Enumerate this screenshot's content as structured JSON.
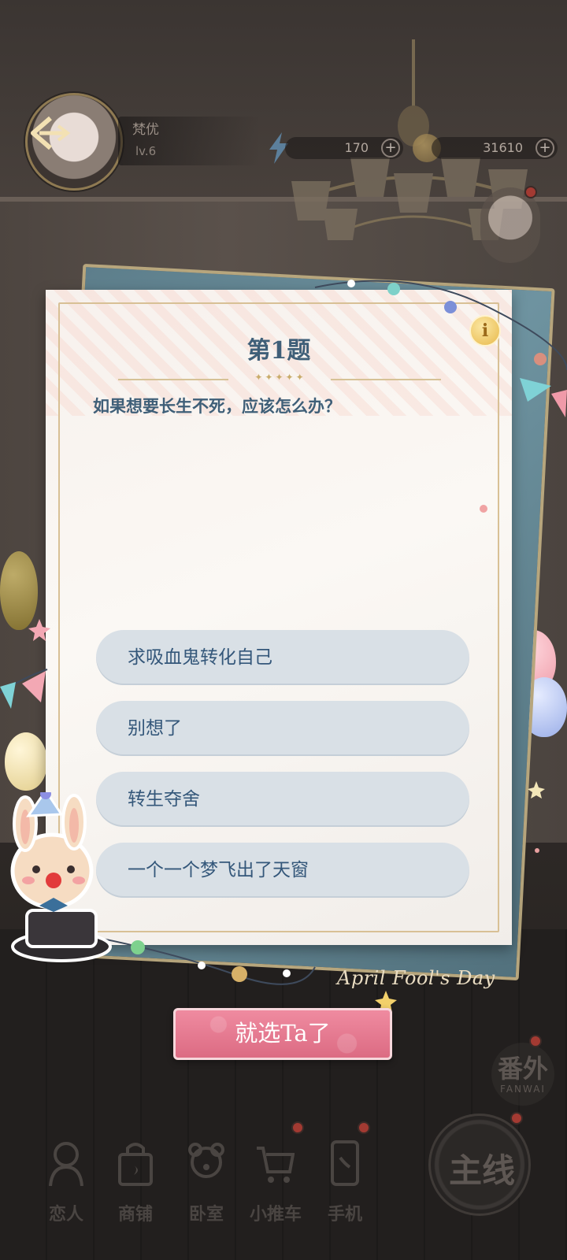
{
  "player": {
    "name": "梵优",
    "level": "lv.6"
  },
  "resources": {
    "energy": "170",
    "coins": "31610",
    "plus": "+"
  },
  "quiz": {
    "title": "第1题",
    "question": "如果想要长生不死，应该怎么办？",
    "info": "i",
    "options": [
      "求吸血鬼转化自己",
      "别想了",
      "转生夺舍",
      "一个一个梦飞出了天窗"
    ],
    "confirm_label": "就选Ta了",
    "decoration_text": "April Fool's Day"
  },
  "side": {
    "fanwai_cn": "番外",
    "fanwai_en": "FANWAI",
    "main_line": "主线"
  },
  "nav": {
    "items": [
      "恋人",
      "商铺",
      "卧室",
      "小推车",
      "手机"
    ]
  },
  "colors": {
    "accent_text": "#3f5f78",
    "option_bg": "#d9e0e6",
    "confirm_pink": "#dc6b83"
  },
  "icons": {
    "back": "back-arrow-icon",
    "energy": "lightning-icon",
    "coin": "coin-icon"
  }
}
